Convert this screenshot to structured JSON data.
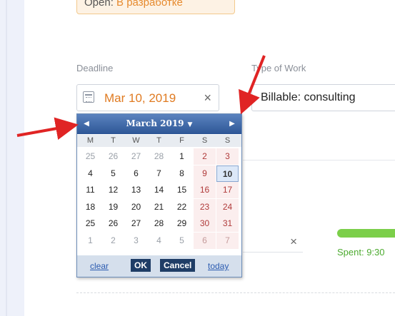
{
  "status": {
    "key": "Open:",
    "value": "В разработке"
  },
  "deadline": {
    "label": "Deadline",
    "value": "Mar 10, 2019",
    "clear_symbol": "×"
  },
  "type_of_work": {
    "label": "Type of Work",
    "value": "Billable: consulting"
  },
  "second_field": {
    "clear_symbol": "×"
  },
  "spent": {
    "label": "Spent: 9:30"
  },
  "calendar": {
    "title": "March 2019",
    "prev_symbol": "◀",
    "next_symbol": "▶",
    "caret": "▼",
    "weekdays": [
      "M",
      "T",
      "W",
      "T",
      "F",
      "S",
      "S"
    ],
    "weeks": [
      [
        "25",
        "26",
        "27",
        "28",
        "1",
        "2",
        "3"
      ],
      [
        "4",
        "5",
        "6",
        "7",
        "8",
        "9",
        "10"
      ],
      [
        "11",
        "12",
        "13",
        "14",
        "15",
        "16",
        "17"
      ],
      [
        "18",
        "19",
        "20",
        "21",
        "22",
        "23",
        "24"
      ],
      [
        "25",
        "26",
        "27",
        "28",
        "29",
        "30",
        "31"
      ],
      [
        "1",
        "2",
        "3",
        "4",
        "5",
        "6",
        "7"
      ]
    ],
    "selected_day": "10",
    "footer": {
      "clear": "clear",
      "ok": "OK",
      "cancel": "Cancel",
      "today": "today"
    }
  },
  "colors": {
    "accent": "#e07b22",
    "header": "#2d5696",
    "arrow": "#e02424",
    "progress": "#7ccf4a"
  }
}
